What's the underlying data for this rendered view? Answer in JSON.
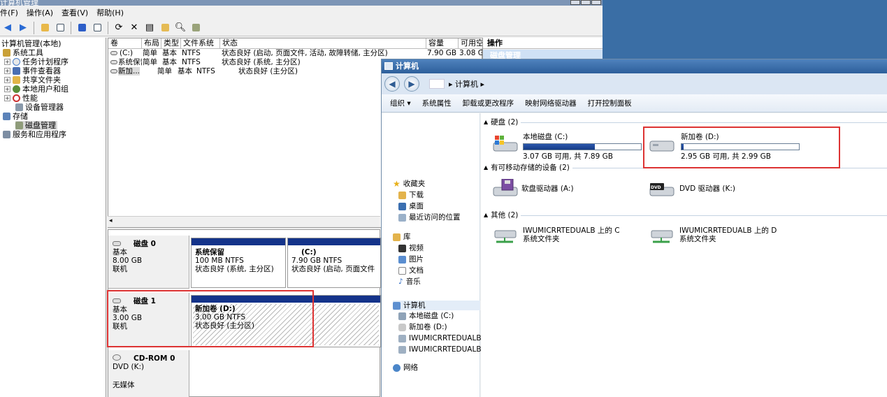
{
  "cm": {
    "title": "计算机管理",
    "menu": [
      "件(F)",
      "操作(A)",
      "查看(V)",
      "帮助(H)"
    ],
    "tree": [
      {
        "label": "计算机管理(本地)",
        "icon": "computer-icon"
      },
      {
        "label": "系统工具",
        "icon": "tools-icon"
      },
      {
        "label": "任务计划程序",
        "icon": "clock-icon",
        "exp": "⊞"
      },
      {
        "label": "事件查看器",
        "icon": "event-viewer-icon",
        "exp": "⊞"
      },
      {
        "label": "共享文件夹",
        "icon": "shared-folder-icon",
        "exp": "⊞"
      },
      {
        "label": "本地用户和组",
        "icon": "users-icon",
        "exp": "⊞"
      },
      {
        "label": "性能",
        "icon": "performance-icon",
        "exp": "⊞"
      },
      {
        "label": "设备管理器",
        "icon": "device-manager-icon"
      },
      {
        "label": "存储",
        "icon": "storage-icon"
      },
      {
        "label": "磁盘管理",
        "icon": "disk-management-icon"
      },
      {
        "label": "服务和应用程序",
        "icon": "services-icon"
      }
    ],
    "volume_headers": [
      "卷",
      "布局",
      "类型",
      "文件系统",
      "状态",
      "容量",
      "可用空"
    ],
    "volumes": [
      {
        "name": "(C:)",
        "layout": "简单",
        "type": "基本",
        "fs": "NTFS",
        "status": "状态良好 (启动, 页面文件, 活动, 故障转储, 主分区)",
        "capacity": "7.90 GB",
        "free": "3.08 G"
      },
      {
        "name": "系统保留",
        "layout": "简单",
        "type": "基本",
        "fs": "NTFS",
        "status": "状态良好 (系统, 主分区)",
        "capacity": "",
        "free": ""
      },
      {
        "name": "新加...",
        "layout": "简单",
        "type": "基本",
        "fs": "NTFS",
        "status": "状态良好 (主分区)",
        "capacity": "",
        "free": ""
      }
    ],
    "actions": {
      "header": "操作",
      "sub": "磁盘管理"
    },
    "disks": [
      {
        "name": "磁盘 0",
        "type": "基本",
        "size": "8.00 GB",
        "state": "联机",
        "partitions": [
          {
            "name": "系统保留",
            "size": "100 MB NTFS",
            "status": "状态良好 (系统, 主分区)"
          },
          {
            "name": "(C:)",
            "size": "7.90 GB NTFS",
            "status": "状态良好 (启动, 页面文件"
          }
        ]
      },
      {
        "name": "磁盘 1",
        "type": "基本",
        "size": "3.00 GB",
        "state": "联机",
        "partitions": [
          {
            "name": "新加卷 (D:)",
            "size": "3.00 GB NTFS",
            "status": "状态良好 (主分区)"
          }
        ]
      },
      {
        "name": "CD-ROM 0",
        "type": "DVD (K:)",
        "size": "",
        "state": "无媒体",
        "partitions": []
      }
    ]
  },
  "ex": {
    "title": "计算机",
    "address": "▸ 计算机 ▸",
    "commands": [
      "组织 ▾",
      "系统属性",
      "卸载或更改程序",
      "映射网络驱动器",
      "打开控制面板"
    ],
    "nav": [
      {
        "label": "收藏夹",
        "icon": "star-icon"
      },
      {
        "label": "下载",
        "icon": "download-folder-icon"
      },
      {
        "label": "桌面",
        "icon": "desktop-icon"
      },
      {
        "label": "最近访问的位置",
        "icon": "recent-places-icon"
      },
      {
        "label": "库",
        "icon": "library-icon"
      },
      {
        "label": "视频",
        "icon": "video-icon"
      },
      {
        "label": "图片",
        "icon": "pictures-icon"
      },
      {
        "label": "文档",
        "icon": "documents-icon"
      },
      {
        "label": "音乐",
        "icon": "music-icon"
      },
      {
        "label": "计算机",
        "icon": "computer-icon"
      },
      {
        "label": "本地磁盘 (C:)",
        "icon": "local-disk-icon"
      },
      {
        "label": "新加卷 (D:)",
        "icon": "drive-icon"
      },
      {
        "label": "IWUMICRRTEDUALB 上",
        "icon": "network-drive-icon"
      },
      {
        "label": "IWUMICRRTEDUALB 上",
        "icon": "network-drive-icon"
      },
      {
        "label": "网络",
        "icon": "network-icon"
      }
    ],
    "groups": {
      "hdd": "硬盘 (2)",
      "removable": "有可移动存储的设备 (2)",
      "other": "其他 (2)"
    },
    "drives": [
      {
        "name": "本地磁盘 (C:)",
        "space": "3.07 GB 可用, 共 7.89 GB",
        "used_fraction": 0.61
      },
      {
        "name": "新加卷 (D:)",
        "space": "2.95 GB 可用, 共 2.99 GB",
        "used_fraction": 0.02
      }
    ],
    "removable": [
      {
        "name": "软盘驱动器 (A:)"
      },
      {
        "name": "DVD 驱动器 (K:)",
        "badge": "DVD"
      }
    ],
    "other": [
      {
        "name": "IWUMICRRTEDUALB 上的 C",
        "sub": "系统文件夹"
      },
      {
        "name": "IWUMICRRTEDUALB 上的 D",
        "sub": "系统文件夹"
      }
    ]
  }
}
